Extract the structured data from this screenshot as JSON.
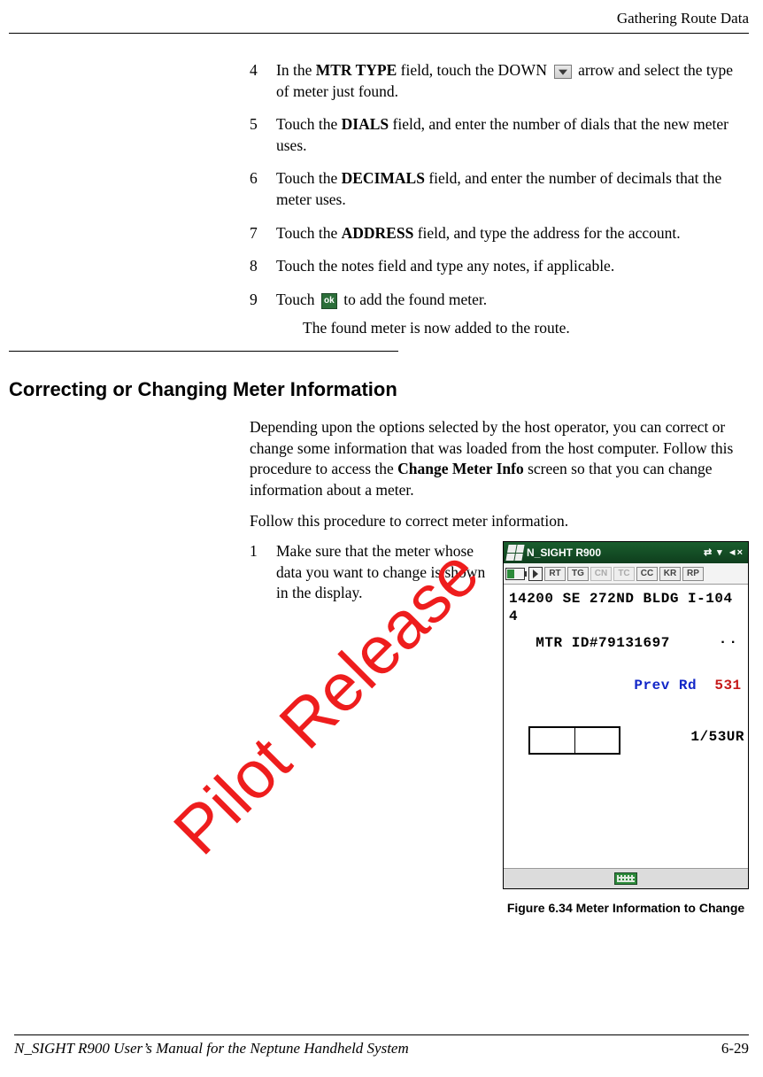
{
  "header": {
    "section": "Gathering Route Data"
  },
  "steps": [
    {
      "num": "4",
      "pre": "In the ",
      "bold1": "MTR TYPE",
      "mid": " field, touch the ",
      "sc": "DOWN",
      "post": " arrow and select the type of meter just found."
    },
    {
      "num": "5",
      "pre": "Touch the ",
      "bold1": "DIALS",
      "post": " field, and enter the number of dials that the new meter uses."
    },
    {
      "num": "6",
      "pre": "Touch the ",
      "bold1": "DECIMALS",
      "post": " field, and enter the number of decimals that the meter uses."
    },
    {
      "num": "7",
      "pre": "Touch the ",
      "bold1": "ADDRESS",
      "post": " field, and type the address for the account."
    },
    {
      "num": "8",
      "text": "Touch the notes field and type any notes, if applicable."
    },
    {
      "num": "9",
      "pre": "Touch ",
      "ok": "ok",
      "post": " to add the found meter.",
      "after": "The found meter is now added to the route."
    }
  ],
  "section_title": "Correcting or Changing Meter Information",
  "paragraphs": {
    "p1a": "Depending upon the options selected by the host operator, you can correct or change some information that was loaded from the host computer. Follow this procedure to access the ",
    "p1_bold": "Change Meter Info",
    "p1b": " screen so that you can change information about a meter.",
    "p2": "Follow this procedure to correct meter information."
  },
  "step1": {
    "num": "1",
    "text": "Make sure that the meter whose data you want to change is shown in the dis­play."
  },
  "device": {
    "title": "N_SIGHT R900",
    "toolbar": [
      "RT",
      "TG",
      "CN",
      "TC",
      "CC",
      "KR",
      "RP"
    ],
    "line1": "14200 SE 272ND BLDG I-104",
    "line2": "4",
    "mtr": "   MTR ID#79131697",
    "prev_label": "Prev Rd",
    "prev_value": "531",
    "seq": "1/53UR",
    "dots": ".."
  },
  "figure_caption": "Figure 6.34   Meter Information to Change",
  "footer": {
    "left": "N_SIGHT R900 User’s Manual for the Neptune Handheld System",
    "right": "6-29"
  },
  "watermark": "Pilot Release"
}
